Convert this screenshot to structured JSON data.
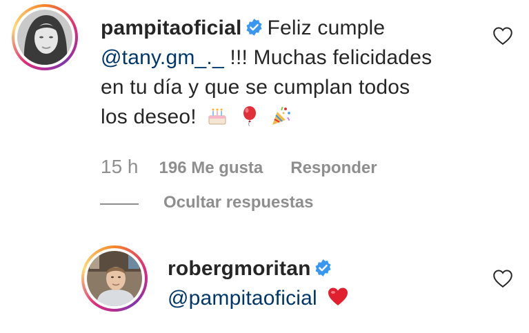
{
  "comment1": {
    "username": "pampitaoficial",
    "text_intro": "Feliz cumple",
    "mention": "@tany.gm_._",
    "text_rest_1": "!!! Muchas felicidades",
    "text_rest_2": "en tu día y que se cumplan todos",
    "text_rest_3": "los deseo!",
    "emojis": [
      "cake-emoji",
      "balloon-emoji",
      "party-popper-emoji"
    ],
    "time": "15 h",
    "likes": "196 Me gusta",
    "reply_label": "Responder"
  },
  "replies_toggle": {
    "label": "Ocultar respuestas"
  },
  "comment2": {
    "username": "robergmoritan",
    "mention": "@pampitaoficial",
    "emoji": "red-heart-emoji"
  },
  "colors": {
    "text": "#262626",
    "mention": "#00376b",
    "meta": "#8e8e8e",
    "verified": "#3897f0",
    "heart": "#ed4956"
  }
}
